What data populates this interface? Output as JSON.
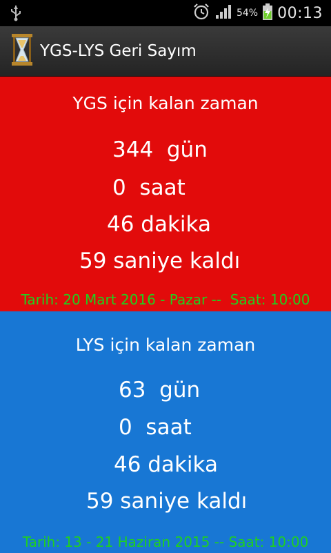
{
  "status_bar": {
    "battery_percent": "54%",
    "time": "00:13"
  },
  "app": {
    "title": "YGS-LYS Geri Sayım"
  },
  "ygs": {
    "heading": "YGS için kalan zaman",
    "days": "344  gün",
    "hours": "0  saat",
    "minutes": "46 dakika",
    "seconds": "59 saniye kaldı",
    "date_line": "Tarih: 20 Mart 2016 - Pazar --  Saat: 10:00"
  },
  "lys": {
    "heading": "LYS için kalan zaman",
    "days": "63  gün",
    "hours": "0  saat",
    "minutes": "46 dakika",
    "seconds": "59 saniye kaldı",
    "date_line": "Tarih: 13 - 21 Haziran 2015 -- Saat: 10:00"
  },
  "colors": {
    "ygs_background": "#e20b0b",
    "lys_background": "#1877d4",
    "date_text": "#1fd01f"
  }
}
